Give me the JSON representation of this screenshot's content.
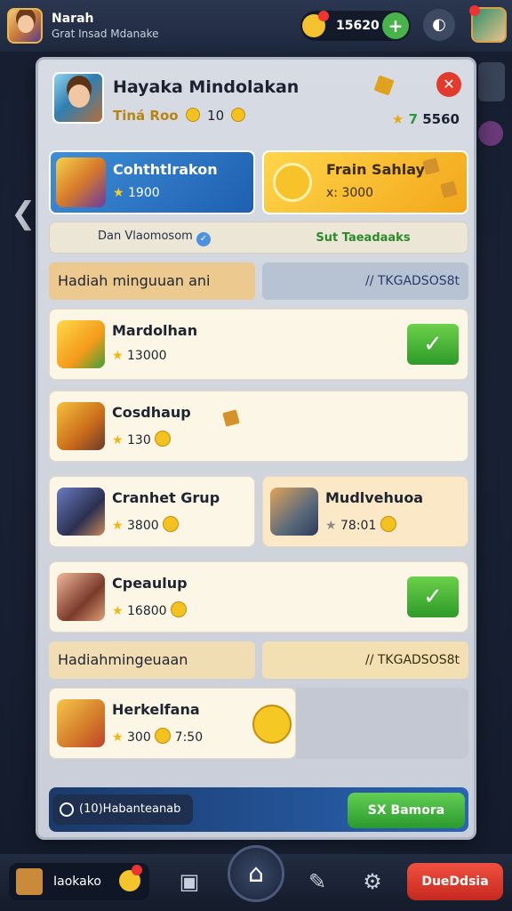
{
  "header": {
    "player_name": "Narah",
    "player_sub": "Grat Insad Mdanake",
    "currency_value": "15620",
    "currency_plus": "+",
    "camera_icon": "camera-icon"
  },
  "panel": {
    "title": "Hayaka Mindolakan",
    "sub_label": "Tiná Roo",
    "sub_value": "10",
    "score_number": "7",
    "score_value": "5560",
    "close": "✕"
  },
  "features": [
    {
      "title": "Cohthtlrakon",
      "value": "1900"
    },
    {
      "title": "Frain Sahlay",
      "value": "x: 3000"
    }
  ],
  "info": {
    "left": "Dan Vlaomosom",
    "right": "Sut Taeadaaks"
  },
  "sections": [
    {
      "left": "Hadiah minguuan ani",
      "right": "// TKGADSOS8t"
    },
    {
      "left": "Hadiahmingeuaan",
      "right": "// TKGADSOS8t"
    }
  ],
  "rows": [
    {
      "title": "Mardolhan",
      "value": "13000"
    },
    {
      "title": "Cosdhaup",
      "value": "130"
    },
    {
      "title": "Cranhet Grup",
      "value": "3800"
    },
    {
      "title": "Mudlvehuoa",
      "value": "78:01"
    },
    {
      "title": "Cpeaulup",
      "value": "16800"
    },
    {
      "title": "Herkelfana",
      "value": "300",
      "value2": "7:50"
    }
  ],
  "bottom_bar": {
    "left": "(10)Habanteanab",
    "right": "SX Bamora"
  },
  "nav": {
    "left": "Iaokako",
    "right": "DueDdsia"
  },
  "colors": {
    "accent_green": "#3fa53a",
    "accent_red": "#e23b2e",
    "panel_bg": "#d7dbe3"
  }
}
